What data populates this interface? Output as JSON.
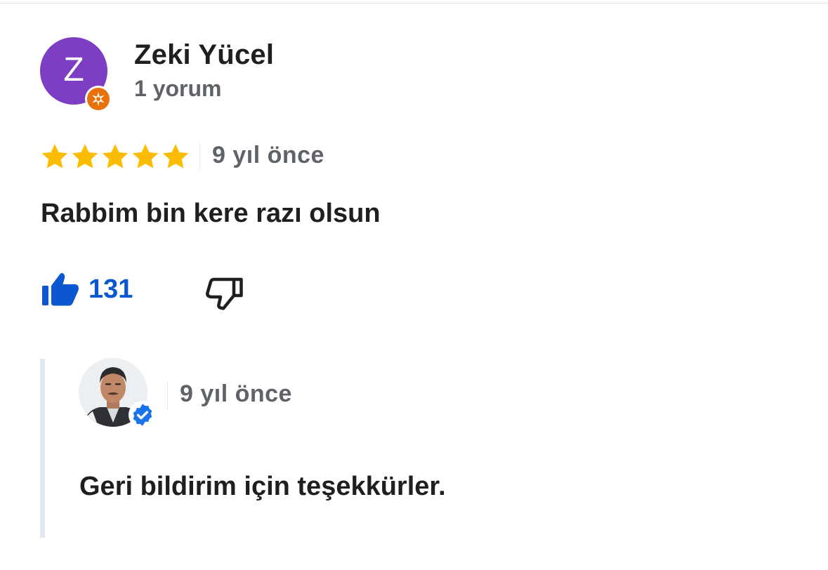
{
  "review": {
    "author": {
      "initial": "Z",
      "name": "Zeki Yücel",
      "review_count": "1 yorum",
      "avatar_color": "#7e3ec3",
      "badge_icon": "local-guide-icon",
      "badge_color": "#e8710a"
    },
    "rating": 5,
    "rating_max": 5,
    "star_color": "#fbbc04",
    "time": "9 yıl önce",
    "text": "Rabbim bin kere razı olsun",
    "likes": {
      "count": "131",
      "icon": "thumbs-up-filled-icon",
      "color": "#0b57d0"
    },
    "dislike": {
      "icon": "thumbs-down-outline-icon"
    }
  },
  "owner_reply": {
    "avatar_icon": "owner-photo",
    "badge_icon": "verified-check-icon",
    "badge_color": "#1a73e8",
    "time": "9 yıl önce",
    "text": "Geri bildirim için teşekkürler."
  }
}
